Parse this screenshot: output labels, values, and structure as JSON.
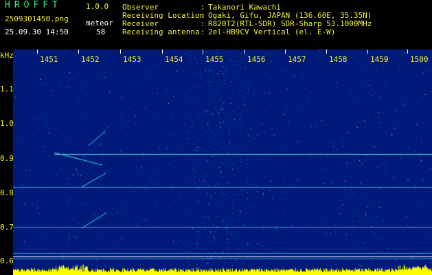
{
  "header": {
    "title": "HROFFT",
    "version": "1.0.0",
    "filename": "2509301450.png",
    "datetime": "25.09.30 14:50",
    "meteor_label": "meteor",
    "meteor_count": "58"
  },
  "info": [
    {
      "label": "Observer",
      "value": "Takanori Kawachi"
    },
    {
      "label": "Receiving Location",
      "value": "Ogaki, Gifu, JAPAN (136.60E, 35.35N)"
    },
    {
      "label": "Receiver",
      "value": "R820T2(RTL-SDR) SDR-Sharp 53.1000MHz"
    },
    {
      "label": "Receiving antenna",
      "value": "2el-HB9CV Vertical (el. E-W)"
    }
  ],
  "info_separator": ":",
  "spectrogram": {
    "unit": "kHz",
    "time_ticks": [
      "1451",
      "1452",
      "1453",
      "1454",
      "1455",
      "1456",
      "1457",
      "1458",
      "1459",
      "1500"
    ],
    "freq_ticks": [
      "1.1",
      "1.0",
      "0.9",
      "0.8",
      "0.7",
      "0.6"
    ],
    "colors": {
      "background": "#001a7a",
      "noise": "#1e6cff",
      "bright": "#40e0d0",
      "axis_text": "#f2f23a"
    }
  }
}
